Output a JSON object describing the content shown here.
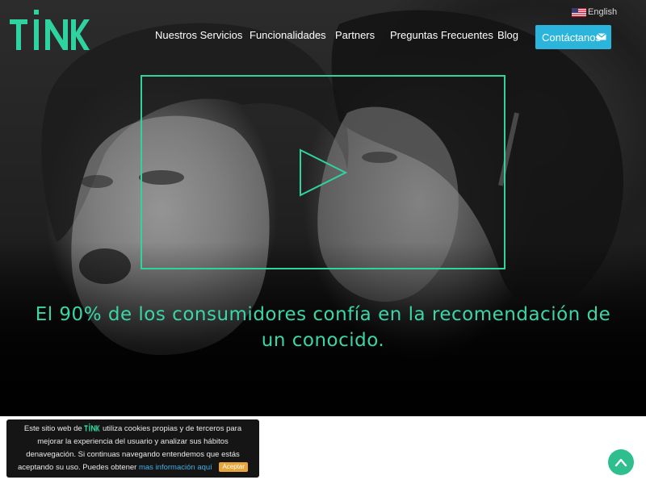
{
  "brand": {
    "logo_text": "TINK",
    "accent_color": "#2fd3a0",
    "button_color": "#2bb5dd"
  },
  "language": {
    "label": "English",
    "flag": "us-flag-icon"
  },
  "nav": {
    "items": [
      {
        "label": "Nuestros Servicios"
      },
      {
        "label": "Funcionalidades"
      },
      {
        "label": "Partners"
      },
      {
        "label": "Preguntas Frecuentes"
      },
      {
        "label": "Blog"
      }
    ],
    "contact_label": "Contáctanos",
    "contact_icon": "mail-icon"
  },
  "hero": {
    "video_icon": "play-icon",
    "headline_line1": "El 90% de los consumidores confía en la recomendación de",
    "headline_line2": "un conocido."
  },
  "cookie": {
    "text_before_logo": "Este sitio web de",
    "text_after_logo": "utiliza cookies propias y de terceros para mejorar la experiencia del usuario y analizar sus hábitos denavegación. Si continuas navegando entendemos que estás aceptando su uso.  Puedes obtener",
    "link_label": "mas información aquí",
    "accept_label": "Aceptar"
  },
  "scroll_top": {
    "icon": "chevron-up-icon"
  }
}
